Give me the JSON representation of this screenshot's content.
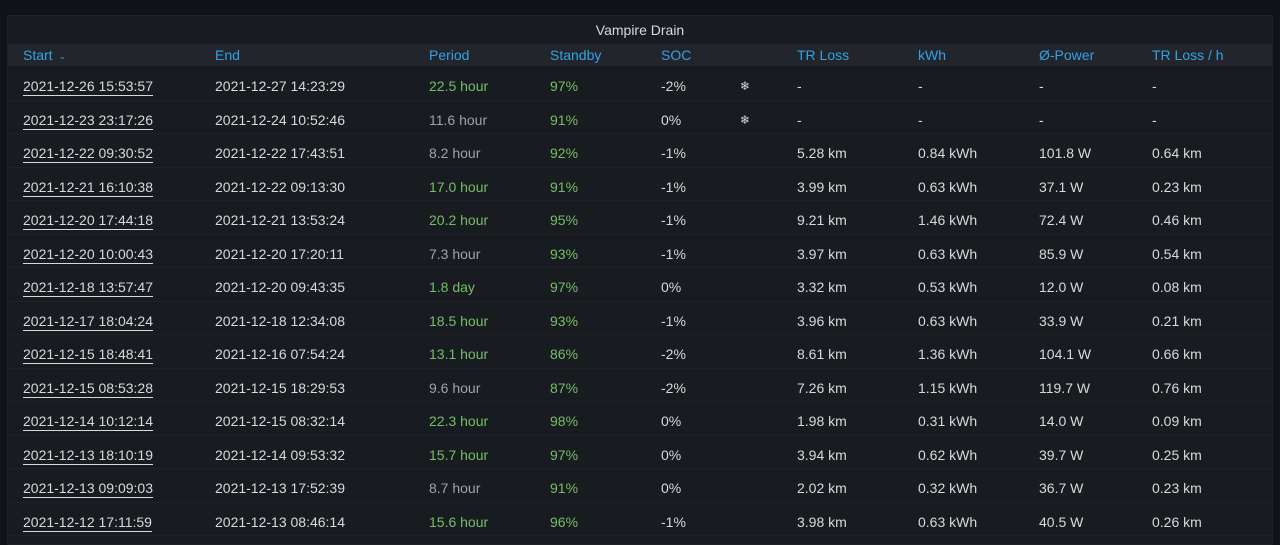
{
  "panel": {
    "title": "Vampire Drain"
  },
  "columns": {
    "start": "Start",
    "end": "End",
    "period": "Period",
    "standby": "Standby",
    "soc": "SOC",
    "tr_loss": "TR Loss",
    "kwh": "kWh",
    "power": "Ø-Power",
    "tr_loss_h": "TR Loss / h",
    "sort_icon": "chevron-down-icon"
  },
  "colors": {
    "background": "#111217",
    "panel": "#181b1f",
    "header_text": "#33a2e5",
    "green": "#73bf69",
    "grey": "#9fa2a7",
    "text": "#d8d9da"
  },
  "rows": [
    {
      "start": "2021-12-26 15:53:57",
      "end": "2021-12-27 14:23:29",
      "period": "22.5 hour",
      "period_color": "green",
      "standby": "97%",
      "soc": "-2%",
      "icon": "❄",
      "tr_loss": "-",
      "kwh": "-",
      "power": "-",
      "tr_loss_h": "-"
    },
    {
      "start": "2021-12-23 23:17:26",
      "end": "2021-12-24 10:52:46",
      "period": "11.6 hour",
      "period_color": "grey",
      "standby": "91%",
      "soc": "0%",
      "icon": "❄",
      "tr_loss": "-",
      "kwh": "-",
      "power": "-",
      "tr_loss_h": "-"
    },
    {
      "start": "2021-12-22 09:30:52",
      "end": "2021-12-22 17:43:51",
      "period": "8.2 hour",
      "period_color": "grey",
      "standby": "92%",
      "soc": "-1%",
      "icon": "",
      "tr_loss": "5.28 km",
      "kwh": "0.84 kWh",
      "power": "101.8 W",
      "tr_loss_h": "0.64 km"
    },
    {
      "start": "2021-12-21 16:10:38",
      "end": "2021-12-22 09:13:30",
      "period": "17.0 hour",
      "period_color": "green",
      "standby": "91%",
      "soc": "-1%",
      "icon": "",
      "tr_loss": "3.99 km",
      "kwh": "0.63 kWh",
      "power": "37.1 W",
      "tr_loss_h": "0.23 km"
    },
    {
      "start": "2021-12-20 17:44:18",
      "end": "2021-12-21 13:53:24",
      "period": "20.2 hour",
      "period_color": "green",
      "standby": "95%",
      "soc": "-1%",
      "icon": "",
      "tr_loss": "9.21 km",
      "kwh": "1.46 kWh",
      "power": "72.4 W",
      "tr_loss_h": "0.46 km"
    },
    {
      "start": "2021-12-20 10:00:43",
      "end": "2021-12-20 17:20:11",
      "period": "7.3 hour",
      "period_color": "grey",
      "standby": "93%",
      "soc": "-1%",
      "icon": "",
      "tr_loss": "3.97 km",
      "kwh": "0.63 kWh",
      "power": "85.9 W",
      "tr_loss_h": "0.54 km"
    },
    {
      "start": "2021-12-18 13:57:47",
      "end": "2021-12-20 09:43:35",
      "period": "1.8 day",
      "period_color": "green",
      "standby": "97%",
      "soc": "0%",
      "icon": "",
      "tr_loss": "3.32 km",
      "kwh": "0.53 kWh",
      "power": "12.0 W",
      "tr_loss_h": "0.08 km"
    },
    {
      "start": "2021-12-17 18:04:24",
      "end": "2021-12-18 12:34:08",
      "period": "18.5 hour",
      "period_color": "green",
      "standby": "93%",
      "soc": "-1%",
      "icon": "",
      "tr_loss": "3.96 km",
      "kwh": "0.63 kWh",
      "power": "33.9 W",
      "tr_loss_h": "0.21 km"
    },
    {
      "start": "2021-12-15 18:48:41",
      "end": "2021-12-16 07:54:24",
      "period": "13.1 hour",
      "period_color": "green",
      "standby": "86%",
      "soc": "-2%",
      "icon": "",
      "tr_loss": "8.61 km",
      "kwh": "1.36 kWh",
      "power": "104.1 W",
      "tr_loss_h": "0.66 km"
    },
    {
      "start": "2021-12-15 08:53:28",
      "end": "2021-12-15 18:29:53",
      "period": "9.6 hour",
      "period_color": "grey",
      "standby": "87%",
      "soc": "-2%",
      "icon": "",
      "tr_loss": "7.26 km",
      "kwh": "1.15 kWh",
      "power": "119.7 W",
      "tr_loss_h": "0.76 km"
    },
    {
      "start": "2021-12-14 10:12:14",
      "end": "2021-12-15 08:32:14",
      "period": "22.3 hour",
      "period_color": "green",
      "standby": "98%",
      "soc": "0%",
      "icon": "",
      "tr_loss": "1.98 km",
      "kwh": "0.31 kWh",
      "power": "14.0 W",
      "tr_loss_h": "0.09 km"
    },
    {
      "start": "2021-12-13 18:10:19",
      "end": "2021-12-14 09:53:32",
      "period": "15.7 hour",
      "period_color": "green",
      "standby": "97%",
      "soc": "0%",
      "icon": "",
      "tr_loss": "3.94 km",
      "kwh": "0.62 kWh",
      "power": "39.7 W",
      "tr_loss_h": "0.25 km"
    },
    {
      "start": "2021-12-13 09:09:03",
      "end": "2021-12-13 17:52:39",
      "period": "8.7 hour",
      "period_color": "grey",
      "standby": "91%",
      "soc": "0%",
      "icon": "",
      "tr_loss": "2.02 km",
      "kwh": "0.32 kWh",
      "power": "36.7 W",
      "tr_loss_h": "0.23 km"
    },
    {
      "start": "2021-12-12 17:11:59",
      "end": "2021-12-13 08:46:14",
      "period": "15.6 hour",
      "period_color": "green",
      "standby": "96%",
      "soc": "-1%",
      "icon": "",
      "tr_loss": "3.98 km",
      "kwh": "0.63 kWh",
      "power": "40.5 W",
      "tr_loss_h": "0.26 km"
    }
  ]
}
